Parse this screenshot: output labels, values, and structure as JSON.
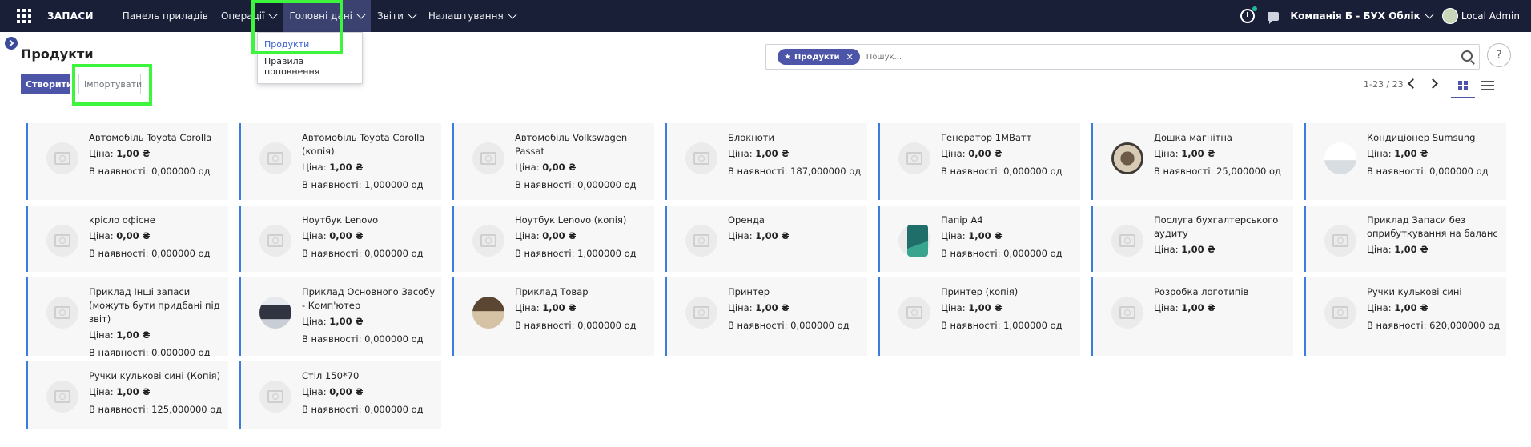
{
  "nav": {
    "brand": "ЗАПАСИ",
    "menu": [
      {
        "label": "Панель приладів",
        "dropdown": false
      },
      {
        "label": "Операції",
        "dropdown": true
      },
      {
        "label": "Головні дані",
        "dropdown": true,
        "active": true
      },
      {
        "label": "Звіти",
        "dropdown": true
      },
      {
        "label": "Налаштування",
        "dropdown": true
      }
    ],
    "company": "Компанія Б - БУХ Облік",
    "user": "Local Admin"
  },
  "dropdown": {
    "items": [
      "Продукти",
      "Правила поповнення"
    ]
  },
  "control": {
    "title": "Продукти",
    "create_label": "Створити",
    "import_label": "Імпортувати",
    "facet_label": "Продукти",
    "search_placeholder": "Пошук...",
    "pager": "1-23 / 23",
    "help": "?"
  },
  "labels": {
    "price": "Ціна:",
    "stock": "В наявності:"
  },
  "products": [
    {
      "name": "Автомобіль Toyota Corolla",
      "price": "1,00 ₴",
      "stock": "0,000000 од",
      "image": "placeholder"
    },
    {
      "name": "Автомобіль Toyota Corolla (копія)",
      "price": "1,00 ₴",
      "stock": "1,000000 од",
      "image": "placeholder"
    },
    {
      "name": "Автомобіль Volkswagen Passat",
      "price": "0,00 ₴",
      "stock": "0,000000 од",
      "image": "placeholder"
    },
    {
      "name": "Блокноти",
      "price": "1,00 ₴",
      "stock": "187,000000 од",
      "image": "placeholder"
    },
    {
      "name": "Генератор 1МВатт",
      "price": "0,00 ₴",
      "stock": "0,000000 од",
      "image": "placeholder"
    },
    {
      "name": "Дошка магнітна",
      "price": "1,00 ₴",
      "stock": "25,000000 од",
      "image": "photo-board"
    },
    {
      "name": "Кондиціонер Sumsung",
      "price": "1,00 ₴",
      "stock": "0,000000 од",
      "image": "photo-ac"
    },
    {
      "name": "крісло офісне",
      "price": "0,00 ₴",
      "stock": "0,000000 од",
      "image": "placeholder"
    },
    {
      "name": "Ноутбук Lenovo",
      "price": "0,00 ₴",
      "stock": "0,000000 од",
      "image": "placeholder"
    },
    {
      "name": "Ноутбук Lenovo (копія)",
      "price": "0,00 ₴",
      "stock": "1,000000 од",
      "image": "placeholder"
    },
    {
      "name": "Оренда",
      "price": "1,00 ₴",
      "stock": null,
      "image": "placeholder"
    },
    {
      "name": "Папір А4",
      "price": "1,00 ₴",
      "stock": "0,000000 од",
      "image": "photo-paper"
    },
    {
      "name": "Послуга бухгалтерського аудиту",
      "price": "1,00 ₴",
      "stock": null,
      "image": "placeholder"
    },
    {
      "name": "Приклад Запаси без оприбуткування на баланс",
      "price": "1,00 ₴",
      "stock": null,
      "image": "placeholder"
    },
    {
      "name": "Приклад Інші запаси (можуть бути придбані під звіт)",
      "price": "1,00 ₴",
      "stock": "0,000000 од",
      "image": "placeholder"
    },
    {
      "name": "Приклад Основного Засобу - Комп'ютер",
      "price": "1,00 ₴",
      "stock": "0,000000 од",
      "image": "photo-computer"
    },
    {
      "name": "Приклад Товар",
      "price": "1,00 ₴",
      "stock": "0,000000 од",
      "image": "photo-goods"
    },
    {
      "name": "Принтер",
      "price": "1,00 ₴",
      "stock": "0,000000 од",
      "image": "placeholder"
    },
    {
      "name": "Принтер (копія)",
      "price": "1,00 ₴",
      "stock": "1,000000 од",
      "image": "placeholder"
    },
    {
      "name": "Розробка логотипів",
      "price": "1,00 ₴",
      "stock": null,
      "image": "placeholder"
    },
    {
      "name": "Ручки кулькові сині",
      "price": "1,00 ₴",
      "stock": "620,000000 од",
      "image": "placeholder"
    },
    {
      "name": "Ручки кулькові сині (Копія)",
      "price": "1,00 ₴",
      "stock": "125,000000 од",
      "image": "placeholder"
    },
    {
      "name": "Стіл 150*70",
      "price": "0,00 ₴",
      "stock": "0,000000 од",
      "image": "placeholder"
    }
  ],
  "colors": {
    "navbar": "#1a1f38",
    "primary": "#4c55a8",
    "card_border": "#3b7ddd",
    "highlight": "#3cf53c"
  }
}
